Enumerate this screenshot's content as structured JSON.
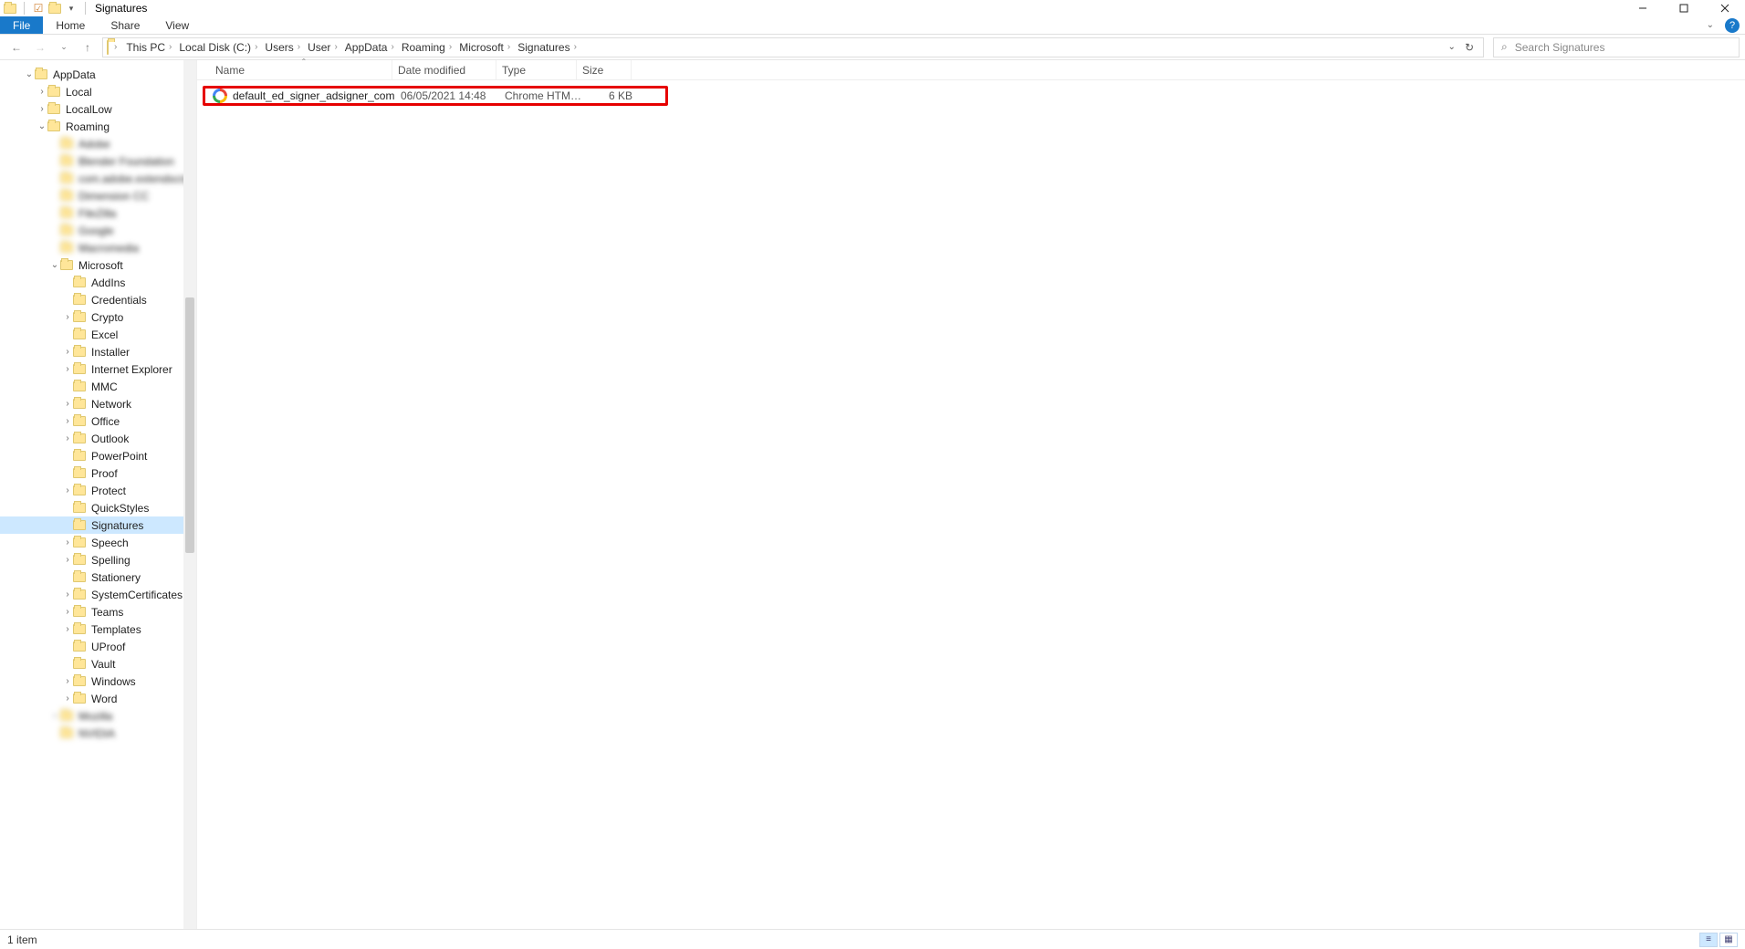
{
  "window": {
    "title": "Signatures"
  },
  "ribbon": {
    "file": "File",
    "home": "Home",
    "share": "Share",
    "view": "View"
  },
  "breadcrumbs": [
    "This PC",
    "Local Disk (C:)",
    "Users",
    "User",
    "AppData",
    "Roaming",
    "Microsoft",
    "Signatures"
  ],
  "search": {
    "placeholder": "Search Signatures"
  },
  "columns": {
    "name": "Name",
    "date": "Date modified",
    "type": "Type",
    "size": "Size"
  },
  "tree": [
    {
      "label": "AppData",
      "depth": 1,
      "twisty": "open",
      "blurred": false
    },
    {
      "label": "Local",
      "depth": 2,
      "twisty": "closed",
      "blurred": false
    },
    {
      "label": "LocalLow",
      "depth": 2,
      "twisty": "closed",
      "blurred": false
    },
    {
      "label": "Roaming",
      "depth": 2,
      "twisty": "open",
      "blurred": false
    },
    {
      "label": "Adobe",
      "depth": 3,
      "twisty": "none",
      "blurred": true
    },
    {
      "label": "Blender Foundation",
      "depth": 3,
      "twisty": "none",
      "blurred": true
    },
    {
      "label": "com.adobe.extendscript",
      "depth": 3,
      "twisty": "none",
      "blurred": true
    },
    {
      "label": "Dimension CC",
      "depth": 3,
      "twisty": "none",
      "blurred": true
    },
    {
      "label": "FileZilla",
      "depth": 3,
      "twisty": "none",
      "blurred": true
    },
    {
      "label": "Google",
      "depth": 3,
      "twisty": "none",
      "blurred": true
    },
    {
      "label": "Macromedia",
      "depth": 3,
      "twisty": "none",
      "blurred": true
    },
    {
      "label": "Microsoft",
      "depth": 3,
      "twisty": "open",
      "blurred": false
    },
    {
      "label": "AddIns",
      "depth": 4,
      "twisty": "none",
      "blurred": false
    },
    {
      "label": "Credentials",
      "depth": 4,
      "twisty": "none",
      "blurred": false
    },
    {
      "label": "Crypto",
      "depth": 4,
      "twisty": "closed",
      "blurred": false
    },
    {
      "label": "Excel",
      "depth": 4,
      "twisty": "none",
      "blurred": false
    },
    {
      "label": "Installer",
      "depth": 4,
      "twisty": "closed",
      "blurred": false
    },
    {
      "label": "Internet Explorer",
      "depth": 4,
      "twisty": "closed",
      "blurred": false
    },
    {
      "label": "MMC",
      "depth": 4,
      "twisty": "none",
      "blurred": false
    },
    {
      "label": "Network",
      "depth": 4,
      "twisty": "closed",
      "blurred": false
    },
    {
      "label": "Office",
      "depth": 4,
      "twisty": "closed",
      "blurred": false
    },
    {
      "label": "Outlook",
      "depth": 4,
      "twisty": "closed",
      "blurred": false
    },
    {
      "label": "PowerPoint",
      "depth": 4,
      "twisty": "none",
      "blurred": false
    },
    {
      "label": "Proof",
      "depth": 4,
      "twisty": "none",
      "blurred": false
    },
    {
      "label": "Protect",
      "depth": 4,
      "twisty": "closed",
      "blurred": false
    },
    {
      "label": "QuickStyles",
      "depth": 4,
      "twisty": "none",
      "blurred": false
    },
    {
      "label": "Signatures",
      "depth": 4,
      "twisty": "none",
      "blurred": false,
      "selected": true
    },
    {
      "label": "Speech",
      "depth": 4,
      "twisty": "closed",
      "blurred": false
    },
    {
      "label": "Spelling",
      "depth": 4,
      "twisty": "closed",
      "blurred": false
    },
    {
      "label": "Stationery",
      "depth": 4,
      "twisty": "none",
      "blurred": false
    },
    {
      "label": "SystemCertificates",
      "depth": 4,
      "twisty": "closed",
      "blurred": false
    },
    {
      "label": "Teams",
      "depth": 4,
      "twisty": "closed",
      "blurred": false
    },
    {
      "label": "Templates",
      "depth": 4,
      "twisty": "closed",
      "blurred": false
    },
    {
      "label": "UProof",
      "depth": 4,
      "twisty": "none",
      "blurred": false
    },
    {
      "label": "Vault",
      "depth": 4,
      "twisty": "none",
      "blurred": false
    },
    {
      "label": "Windows",
      "depth": 4,
      "twisty": "closed",
      "blurred": false
    },
    {
      "label": "Word",
      "depth": 4,
      "twisty": "closed",
      "blurred": false
    },
    {
      "label": "Mozilla",
      "depth": 3,
      "twisty": "closed",
      "blurred": true
    },
    {
      "label": "NVIDIA",
      "depth": 3,
      "twisty": "none",
      "blurred": true
    }
  ],
  "files": [
    {
      "name": "default_ed_signer_adsigner_com",
      "date": "06/05/2021 14:48",
      "type": "Chrome HTML Do...",
      "size": "6 KB",
      "highlighted": true
    }
  ],
  "status": {
    "count": "1 item"
  }
}
